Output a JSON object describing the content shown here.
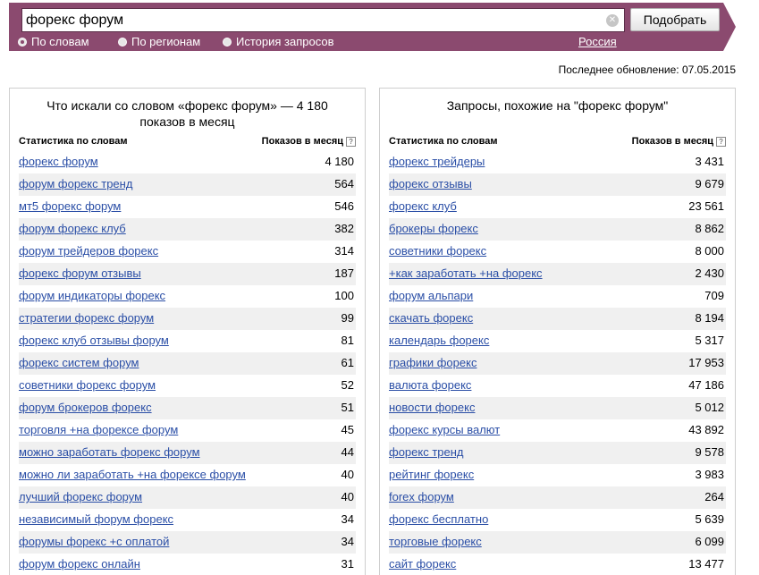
{
  "search": {
    "query": "форекс форум",
    "submit_label": "Подобрать",
    "options": [
      {
        "label": "По словам",
        "checked": true
      },
      {
        "label": "По регионам",
        "checked": false
      },
      {
        "label": "История запросов",
        "checked": false
      }
    ],
    "region": "Россия"
  },
  "last_updated": "Последнее обновление: 07.05.2015",
  "left_panel": {
    "title": "Что искали со словом «форекс форум» — 4 180 показов в месяц",
    "col_left": "Статистика по словам",
    "col_right": "Показов в месяц",
    "rows": [
      {
        "phrase": "форекс форум",
        "count": "4 180"
      },
      {
        "phrase": "форум форекс тренд",
        "count": "564"
      },
      {
        "phrase": "мт5 форекс форум",
        "count": "546"
      },
      {
        "phrase": "форум форекс клуб",
        "count": "382"
      },
      {
        "phrase": "форум трейдеров форекс",
        "count": "314"
      },
      {
        "phrase": "форекс форум отзывы",
        "count": "187"
      },
      {
        "phrase": "форум индикаторы форекс",
        "count": "100"
      },
      {
        "phrase": "стратегии форекс форум",
        "count": "99"
      },
      {
        "phrase": "форекс клуб отзывы форум",
        "count": "81"
      },
      {
        "phrase": "форекс систем форум",
        "count": "61"
      },
      {
        "phrase": "советники форекс форум",
        "count": "52"
      },
      {
        "phrase": "форум брокеров форекс",
        "count": "51"
      },
      {
        "phrase": "торговля +на форексе форум",
        "count": "45"
      },
      {
        "phrase": "можно заработать форекс форум",
        "count": "44"
      },
      {
        "phrase": "можно ли заработать +на форексе форум",
        "count": "40"
      },
      {
        "phrase": "лучший форекс форум",
        "count": "40"
      },
      {
        "phrase": "независимый форум форекс",
        "count": "34"
      },
      {
        "phrase": "форумы форекс +с оплатой",
        "count": "34"
      },
      {
        "phrase": "форум форекс онлайн",
        "count": "31"
      }
    ]
  },
  "right_panel": {
    "title": "Запросы, похожие на \"форекс форум\"",
    "col_left": "Статистика по словам",
    "col_right": "Показов в месяц",
    "rows": [
      {
        "phrase": "форекс трейдеры",
        "count": "3 431"
      },
      {
        "phrase": "форекс отзывы",
        "count": "9 679"
      },
      {
        "phrase": "форекс клуб",
        "count": "23 561"
      },
      {
        "phrase": "брокеры форекс",
        "count": "8 862"
      },
      {
        "phrase": "советники форекс",
        "count": "8 000"
      },
      {
        "phrase": "+как заработать +на форекс",
        "count": "2 430"
      },
      {
        "phrase": "форум альпари",
        "count": "709"
      },
      {
        "phrase": "скачать форекс",
        "count": "8 194"
      },
      {
        "phrase": "календарь форекс",
        "count": "5 317"
      },
      {
        "phrase": "графики форекс",
        "count": "17 953"
      },
      {
        "phrase": "валюта форекс",
        "count": "47 186"
      },
      {
        "phrase": "новости форекс",
        "count": "5 012"
      },
      {
        "phrase": "форекс курсы валют",
        "count": "43 892"
      },
      {
        "phrase": "форекс тренд",
        "count": "9 578"
      },
      {
        "phrase": "рейтинг форекс",
        "count": "3 983"
      },
      {
        "phrase": "forex форум",
        "count": "264"
      },
      {
        "phrase": "форекс бесплатно",
        "count": "5 639"
      },
      {
        "phrase": "торговые форекс",
        "count": "6 099"
      },
      {
        "phrase": "сайт форекс",
        "count": "13 477"
      }
    ]
  },
  "colors": {
    "bar": "#8b4a6f",
    "link": "#2a4ea6",
    "stripe": "#f0f0f0"
  }
}
